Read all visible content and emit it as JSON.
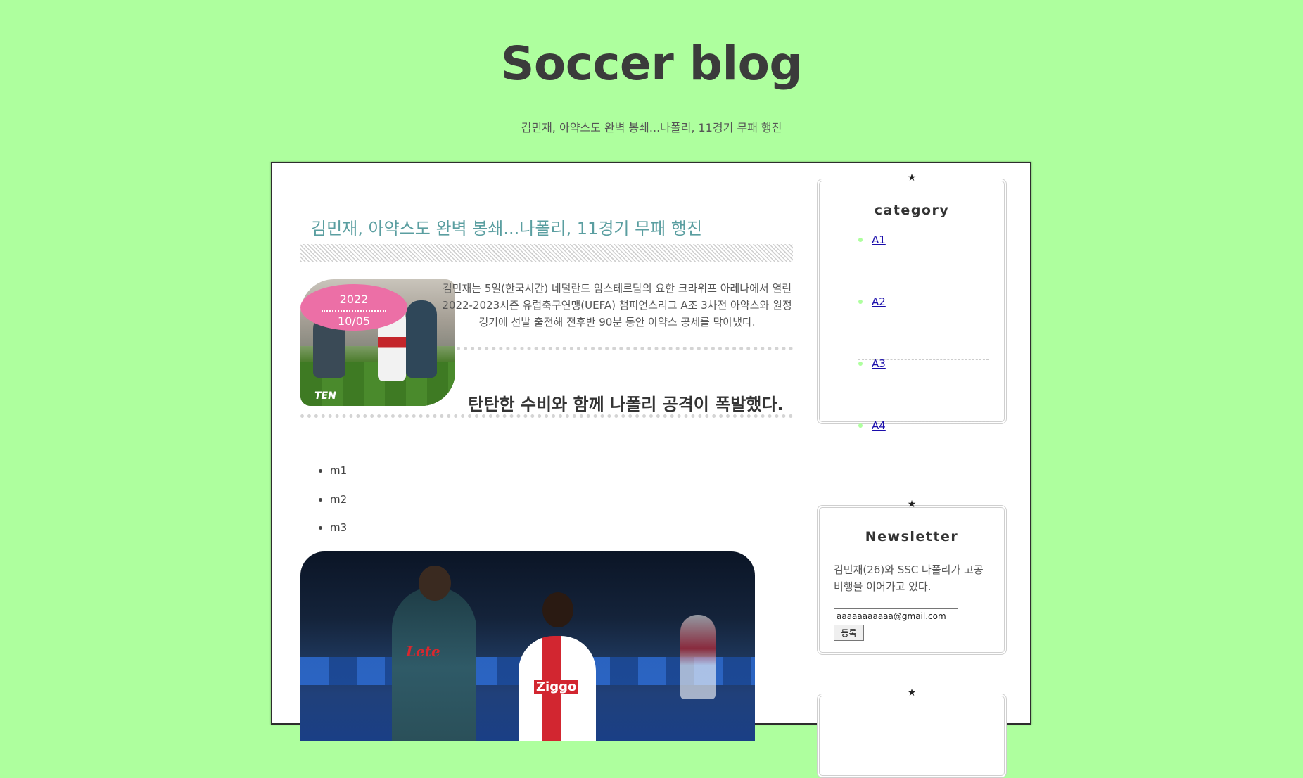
{
  "header": {
    "title": "Soccer blog",
    "subtitle": "김민재, 아약스도 완벽 봉쇄...나폴리, 11경기 무패 행진"
  },
  "post": {
    "title": "김민재, 아약스도 완벽 봉쇄...나폴리, 11경기 무패 행진",
    "date_year": "2022",
    "date_month_day": "10/05",
    "intro": "김민재는 5일(한국시간) 네덜란드 암스테르담의 요한 크라위프 아레나에서 열린 2022-2023시즌 유럽축구연맹(UEFA) 챔피언스리그 A조 3차전 아약스와 원정 경기에 선발 출전해 전후반 90분 동안 아약스 공세를 막아냈다.",
    "subheading": "탄탄한 수비와 함께 나폴리 공격이 폭발했다.",
    "thumb_watermark": "TEN",
    "list": [
      "m1",
      "m2",
      "m3"
    ],
    "hero_sponsors": [
      "Lete",
      "Ziggo"
    ]
  },
  "sidebar": {
    "category": {
      "title": "category",
      "items": [
        "A1",
        "A2",
        "A3",
        "A4"
      ]
    },
    "newsletter": {
      "title": "Newsletter",
      "text": "김민재(26)와 SSC 나폴리가 고공 비행을 이어가고 있다.",
      "email_value": "aaaaaaaaaaa@gmail.com",
      "submit_label": "등록"
    },
    "star_glyph": "★"
  },
  "colors": {
    "page_background": "#aeff9e",
    "post_title": "#5a9ea0",
    "date_badge": "#ec6fa6",
    "link": "#1a0dab"
  }
}
